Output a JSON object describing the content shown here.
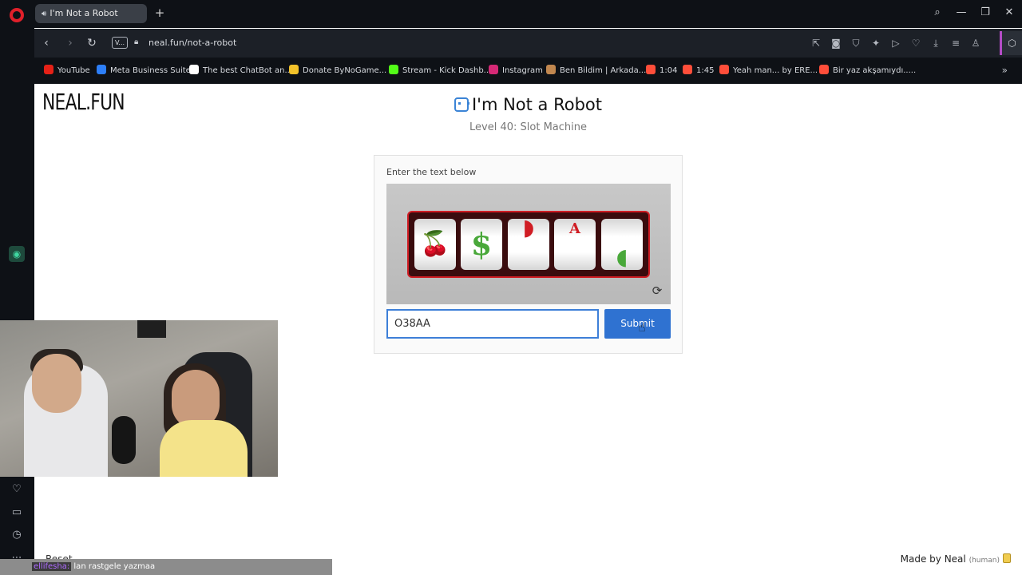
{
  "browser": {
    "tab_title": "I'm Not a Robot",
    "url": "neal.fun/not-a-robot",
    "vpn_label": "V...",
    "bookmarks": [
      {
        "label": "YouTube",
        "color": "#e62117"
      },
      {
        "label": "Meta Business Suite",
        "color": "#2d7ff9"
      },
      {
        "label": "The best ChatBot an...",
        "color": "#ffffff"
      },
      {
        "label": "Donate ByNoGame...",
        "color": "#f3c22a"
      },
      {
        "label": "Stream - Kick Dashb...",
        "color": "#53fc18"
      },
      {
        "label": "Instagram",
        "color": "#d62976"
      },
      {
        "label": "Ben Bildim | Arkada...",
        "color": "#c1874f"
      },
      {
        "label": "1:04",
        "color": "#ff4e3a"
      },
      {
        "label": "1:45",
        "color": "#ff4e3a"
      },
      {
        "label": "Yeah man... by ERE...",
        "color": "#ff4e3a"
      },
      {
        "label": "Bir yaz akşamıydı.....",
        "color": "#ff4e3a"
      }
    ]
  },
  "page": {
    "logo": "NEAL.FUN",
    "title": "I'm Not a Robot",
    "level": "Level 40: Slot Machine"
  },
  "captcha": {
    "instruction": "Enter the text below",
    "reels": [
      {
        "symbol": "🍒",
        "color": "#d01d24"
      },
      {
        "symbol": "$",
        "color": "#49a83a"
      },
      {
        "symbol": "◗",
        "color": "#d01d24"
      },
      {
        "symbol": "A",
        "color": "#d01d24"
      },
      {
        "symbol": "◖",
        "color": "#49a83a"
      }
    ],
    "input_value": "O38AA",
    "submit_label": "Submit"
  },
  "footer": {
    "reset_label": "Reset",
    "chat_user": "ellifesha:",
    "chat_text": "lan rastgele yazmaa",
    "made_by": "Made by Neal",
    "human": "(human)"
  }
}
